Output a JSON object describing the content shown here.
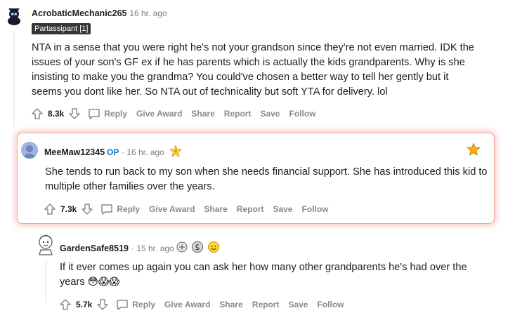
{
  "comments": [
    {
      "username": "AcrobaticMechanic265",
      "time": "· 16 hr. ago",
      "flair": "Partassipant [1]",
      "body": "NTA in a sense that you were right he's not your grandson since they're not even married. IDK the issues of your son's GF ex if he has parents which is actually the kids grandparents. Why is she insisting to make you the grandma? You could've chosen a better way to tell her gently but it seems you dont like her. So NTA out of technicality but soft YTA for delivery. lol",
      "score": "8.3k"
    },
    {
      "username": "MeeMaw12345",
      "op": "OP",
      "time": "· 16 hr. ago",
      "body": "She tends to run back to my son when she needs financial support. She has introduced this kid to multiple other families over the years.",
      "score": "7.3k"
    },
    {
      "username": "GardenSafe8519",
      "time": "· 15 hr. ago",
      "body": "If it ever comes up again you can ask her how many other grandparents he's had over the years 😳😱😱",
      "score": "5.7k"
    }
  ],
  "actions": {
    "reply": "Reply",
    "give_award": "Give Award",
    "share": "Share",
    "report": "Report",
    "save": "Save",
    "follow": "Follow"
  },
  "colors": {
    "op_blue": "#0079d3",
    "highlight_border": "#f2a7a1",
    "action_gray": "#878a8c"
  }
}
